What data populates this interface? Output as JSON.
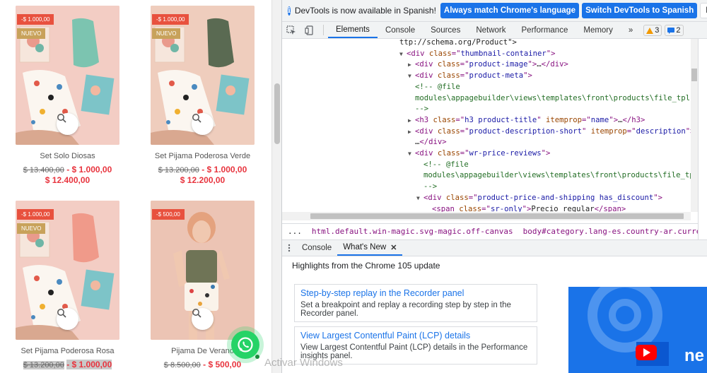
{
  "products": [
    {
      "name": "Set Solo Diosas",
      "discount_badge": "-$ 1.000,00",
      "new_badge": "NUEVO",
      "old_price": "$ 13.400,00",
      "discount": "- $ 1.000,00",
      "price": "$ 12.400,00",
      "photo_bg": "#f2c8c0"
    },
    {
      "name": "Set Pijama Poderosa Verde",
      "discount_badge": "-$ 1.000,00",
      "new_badge": "NUEVO",
      "old_price": "$ 13.200,00",
      "discount": "- $ 1.000,00",
      "price": "$ 12.200,00",
      "photo_bg": "#f0c8b8"
    },
    {
      "name": "Set Pijama Poderosa Rosa",
      "discount_badge": "-$ 1.000,00",
      "new_badge": "NUEVO",
      "old_price": "$ 13.200,00",
      "discount": "- $ 1.000,00",
      "price": "",
      "photo_bg": "#f2c4bc"
    },
    {
      "name": "Pijama De Verano",
      "discount_badge": "-$ 500,00",
      "new_badge": "",
      "old_price": "$ 8.500,00",
      "discount": "- $ 500,00",
      "price": "",
      "photo_bg": "#e9b8a8"
    }
  ],
  "devtools": {
    "infobar": {
      "message": "DevTools is now available in Spanish!",
      "match_button": "Always match Chrome's language",
      "switch_button": "Switch DevTools to Spanish",
      "dont_show": "Don't show"
    },
    "tabs": [
      "Elements",
      "Console",
      "Sources",
      "Network",
      "Performance",
      "Memory"
    ],
    "more_tabs": "»",
    "warnings_count": "3",
    "issues_count": "2",
    "dom_lines": [
      {
        "indent": 0,
        "tri": "",
        "parts": [
          [
            "txt",
            "ttp://schema.org/Product\">"
          ]
        ]
      },
      {
        "indent": 1,
        "tri": "▼",
        "parts": [
          [
            "tag",
            "<div "
          ],
          [
            "an",
            "class"
          ],
          [
            "tag",
            "=\""
          ],
          [
            "av",
            "thumbnail-container"
          ],
          [
            "tag",
            "\">"
          ]
        ]
      },
      {
        "indent": 2,
        "tri": "▶",
        "parts": [
          [
            "tag",
            "<div "
          ],
          [
            "an",
            "class"
          ],
          [
            "tag",
            "=\""
          ],
          [
            "av",
            "product-image"
          ],
          [
            "tag",
            "\">"
          ],
          [
            "txt",
            "…"
          ],
          [
            "tag",
            "</div>"
          ]
        ]
      },
      {
        "indent": 2,
        "tri": "▼",
        "parts": [
          [
            "tag",
            "<div "
          ],
          [
            "an",
            "class"
          ],
          [
            "tag",
            "=\""
          ],
          [
            "av",
            "product-meta"
          ],
          [
            "tag",
            "\">"
          ]
        ]
      },
      {
        "indent": 3,
        "tri": "",
        "parts": [
          [
            "cm",
            "<!-- @file"
          ]
        ]
      },
      {
        "indent": 3,
        "tri": "",
        "parts": [
          [
            "cm",
            "modules\\appagebuilder\\views\\templates\\front\\products\\file_tpl"
          ]
        ]
      },
      {
        "indent": 3,
        "tri": "",
        "parts": [
          [
            "cm",
            "-->"
          ]
        ]
      },
      {
        "indent": 3,
        "tri": "▶",
        "parts": [
          [
            "tag",
            "<h3 "
          ],
          [
            "an",
            "class"
          ],
          [
            "tag",
            "=\""
          ],
          [
            "av",
            "h3 product-title"
          ],
          [
            "tag",
            "\" "
          ],
          [
            "an",
            "itemprop"
          ],
          [
            "tag",
            "=\""
          ],
          [
            "av",
            "name"
          ],
          [
            "tag",
            "\">"
          ],
          [
            "txt",
            "…"
          ],
          [
            "tag",
            "</h3>"
          ]
        ]
      },
      {
        "indent": 3,
        "tri": "▶",
        "parts": [
          [
            "tag",
            "<div "
          ],
          [
            "an",
            "class"
          ],
          [
            "tag",
            "=\""
          ],
          [
            "av",
            "product-description-short"
          ],
          [
            "tag",
            "\" "
          ],
          [
            "an",
            "itemprop"
          ],
          [
            "tag",
            "=\""
          ],
          [
            "av",
            "description"
          ],
          [
            "tag",
            "\">"
          ]
        ]
      },
      {
        "indent": 3,
        "tri": "",
        "parts": [
          [
            "txt",
            "…"
          ],
          [
            "tag",
            "</div>"
          ]
        ]
      },
      {
        "indent": 3,
        "tri": "▼",
        "parts": [
          [
            "tag",
            "<div "
          ],
          [
            "an",
            "class"
          ],
          [
            "tag",
            "=\""
          ],
          [
            "av",
            "wr-price-reviews"
          ],
          [
            "tag",
            "\">"
          ]
        ]
      },
      {
        "indent": 4,
        "tri": "",
        "parts": [
          [
            "cm",
            "<!-- @file"
          ]
        ]
      },
      {
        "indent": 4,
        "tri": "",
        "parts": [
          [
            "cm",
            "modules\\appagebuilder\\views\\templates\\front\\products\\file_tpl"
          ]
        ]
      },
      {
        "indent": 4,
        "tri": "",
        "parts": [
          [
            "cm",
            "-->"
          ]
        ]
      },
      {
        "indent": 4,
        "tri": "▼",
        "parts": [
          [
            "tag",
            "<div "
          ],
          [
            "an",
            "class"
          ],
          [
            "tag",
            "=\""
          ],
          [
            "av",
            "product-price-and-shipping has_discount"
          ],
          [
            "tag",
            "\">"
          ]
        ]
      },
      {
        "indent": 5,
        "tri": "",
        "parts": [
          [
            "tag",
            "<span "
          ],
          [
            "an",
            "class"
          ],
          [
            "tag",
            "=\""
          ],
          [
            "av",
            "sr-only"
          ],
          [
            "tag",
            "\">"
          ],
          [
            "txt",
            "Precio regular"
          ],
          [
            "tag",
            "</span>"
          ]
        ]
      }
    ],
    "breadcrumbs": {
      "ellipsis": "...",
      "html": "html.default.win-magic.svg-magic.off-canvas",
      "body": "body#category.lang-es.country-ar.currency-ars.layout-left-co"
    },
    "drawer_tabs": [
      "Console",
      "What's New"
    ],
    "highlights": "Highlights from the Chrome 105 update",
    "cards": [
      {
        "title": "Step-by-step replay in the Recorder panel",
        "desc": "Set a breakpoint and replay a recording step by step in the Recorder panel."
      },
      {
        "title": "View Largest Contentful Paint (LCP) details",
        "desc": "View Largest Contentful Paint (LCP) details in the Performance insights panel."
      }
    ],
    "watermark": "Activar Windows",
    "promo_text": "ne"
  }
}
